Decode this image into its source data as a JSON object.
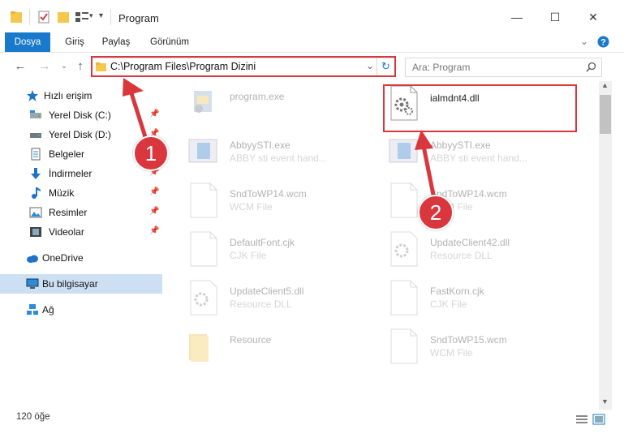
{
  "window": {
    "title": "Program"
  },
  "ribbon": {
    "tabs": [
      "Dosya",
      "Giriş",
      "Paylaş",
      "Görünüm"
    ]
  },
  "address": {
    "path": "C:\\Program Files\\Program Dizini"
  },
  "search": {
    "placeholder": "Ara: Program"
  },
  "sidebar": {
    "items": [
      {
        "label": "Hızlı erişim",
        "icon": "star-icon"
      },
      {
        "label": "Yerel Disk (C:)",
        "icon": "drive-icon",
        "pinned": true
      },
      {
        "label": "Yerel Disk (D:)",
        "icon": "drive-icon",
        "pinned": true
      },
      {
        "label": "Belgeler",
        "icon": "documents-icon",
        "pinned": true
      },
      {
        "label": "İndirmeler",
        "icon": "download-icon",
        "pinned": true
      },
      {
        "label": "Müzik",
        "icon": "music-icon",
        "pinned": true
      },
      {
        "label": "Resimler",
        "icon": "pictures-icon",
        "pinned": true
      },
      {
        "label": "Videolar",
        "icon": "videos-icon",
        "pinned": true
      },
      {
        "label": "OneDrive",
        "icon": "cloud-icon"
      },
      {
        "label": "Bu bilgisayar",
        "icon": "computer-icon",
        "selected": true
      },
      {
        "label": "Ağ",
        "icon": "network-icon"
      }
    ]
  },
  "files": [
    {
      "name": "program.exe",
      "type": "",
      "icon": "exe-icon",
      "highlighted": false
    },
    {
      "name": "ialmdnt4.dll",
      "type": "",
      "icon": "dll-icon",
      "highlighted": true
    },
    {
      "name": "AbbyySTI.exe",
      "type": "ABBY sti event hand...",
      "icon": "app-icon"
    },
    {
      "name": "AbbyySTI.exe",
      "type": "ABBY sti event hand...",
      "icon": "app-icon"
    },
    {
      "name": "SndToWP14.wcm",
      "type": "WCM File",
      "icon": "file-icon"
    },
    {
      "name": "SndToWP14.wcm",
      "type": "WCM File",
      "icon": "file-icon"
    },
    {
      "name": "DefaultFont.cjk",
      "type": "CJK File",
      "icon": "file-icon"
    },
    {
      "name": "UpdateClient42.dll",
      "type": "Resource DLL",
      "icon": "dll-icon"
    },
    {
      "name": "UpdateClient5.dll",
      "type": "Resource DLL",
      "icon": "dll-icon"
    },
    {
      "name": "FastKorn.cjk",
      "type": "CJK File",
      "icon": "file-icon"
    },
    {
      "name": "Resource",
      "type": "",
      "icon": "folder-icon"
    },
    {
      "name": "SndToWP15.wcm",
      "type": "WCM File",
      "icon": "file-icon"
    }
  ],
  "status": {
    "count": "120 öğe"
  },
  "callouts": {
    "one": "1",
    "two": "2"
  },
  "colors": {
    "accent": "#1979ca",
    "highlight": "#d9363e",
    "selection": "#cde0f3"
  }
}
